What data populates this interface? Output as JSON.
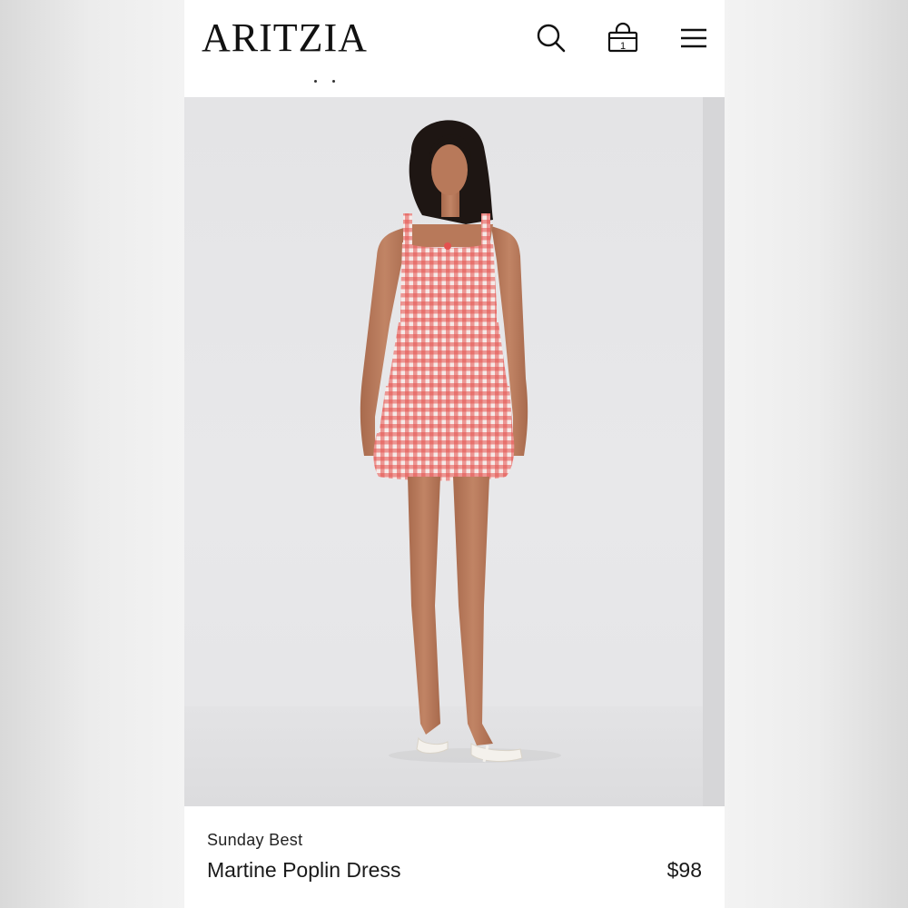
{
  "brand": {
    "logo_text": "ARITZIA"
  },
  "header": {
    "icons": [
      "search-icon",
      "shopping-bag-icon",
      "menu-icon"
    ],
    "bag_count": "1"
  },
  "product": {
    "collection": "Sunday Best",
    "name": "Martine Poplin Dress",
    "price": "$98"
  },
  "colors": {
    "dress_red": "#e4524f",
    "dress_white": "#f6e9e7",
    "skin": "#b8795a",
    "hair": "#1e1613",
    "background": "#e6e6e8",
    "text": "#1a1a1a"
  }
}
